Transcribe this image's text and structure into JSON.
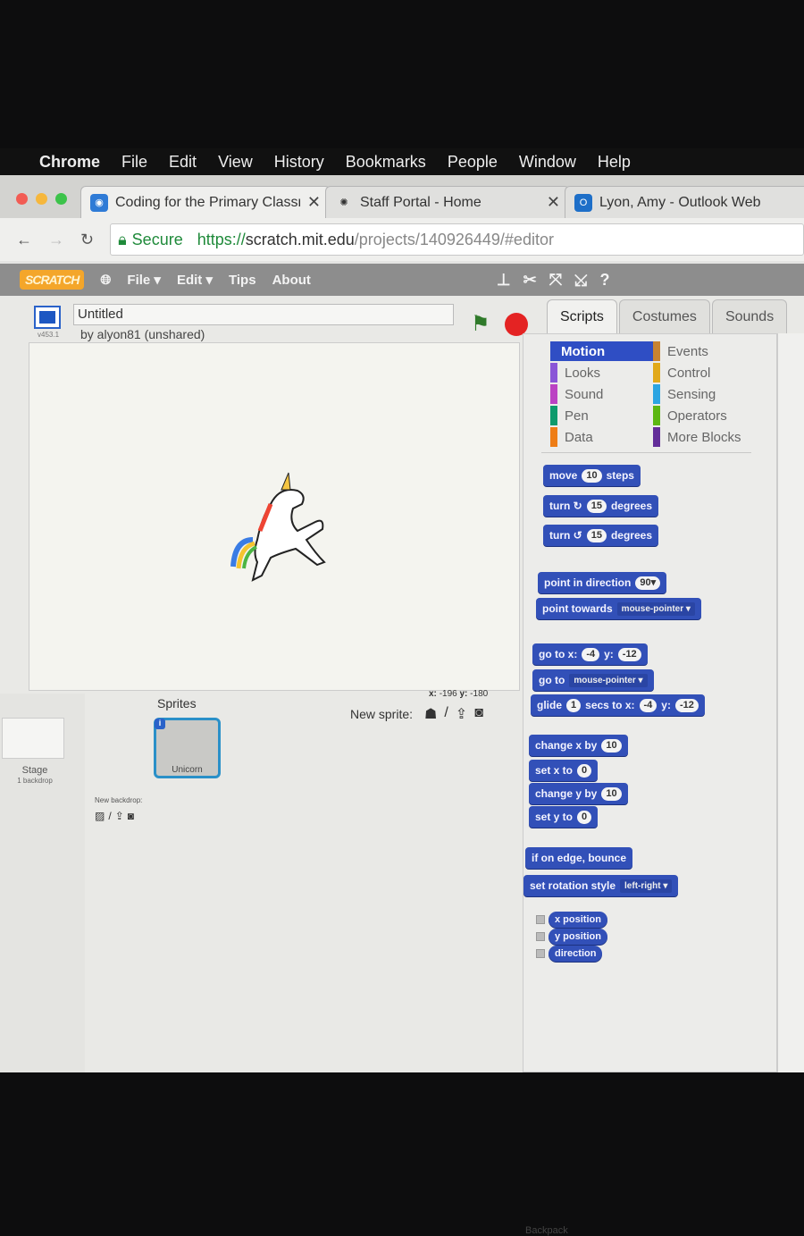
{
  "os_menu": {
    "app": "Chrome",
    "items": [
      "File",
      "Edit",
      "View",
      "History",
      "Bookmarks",
      "People",
      "Window",
      "Help"
    ]
  },
  "browser": {
    "tabs": [
      {
        "label": "Coding for the Primary Classroom",
        "icon": "scratch-favicon"
      },
      {
        "label": "Staff Portal - Home",
        "icon": "nsw-favicon"
      },
      {
        "label": "Lyon, Amy - Outlook Web",
        "icon": "outlook-favicon"
      }
    ],
    "secure_label": "Secure",
    "url_scheme": "https://",
    "url_host": "scratch.mit.edu",
    "url_path": "/projects/140926449/#editor"
  },
  "scratch": {
    "logo": "SCRATCH",
    "menu": [
      "File ▾",
      "Edit ▾",
      "Tips",
      "About"
    ],
    "project_title": "Untitled",
    "author": "by alyon81 (unshared)",
    "version": "v453.1",
    "tabs": [
      "Scripts",
      "Costumes",
      "Sounds"
    ],
    "categories": [
      {
        "label": "Motion",
        "color": "#4a6cd4"
      },
      {
        "label": "Looks",
        "color": "#8a55d7"
      },
      {
        "label": "Sound",
        "color": "#bb42c3"
      },
      {
        "label": "Pen",
        "color": "#0e9a6c"
      },
      {
        "label": "Data",
        "color": "#ee7d16"
      },
      {
        "label": "Events",
        "color": "#c88330"
      },
      {
        "label": "Control",
        "color": "#e1a91a"
      },
      {
        "label": "Sensing",
        "color": "#2ca5e2"
      },
      {
        "label": "Operators",
        "color": "#5cb712"
      },
      {
        "label": "More Blocks",
        "color": "#632d99"
      }
    ],
    "coords": {
      "x_label": "x:",
      "x": "-196",
      "y_label": "y:",
      "y": "-180"
    },
    "sprites_label": "Sprites",
    "new_sprite_label": "New sprite:",
    "stage_label": "Stage",
    "stage_sub": "1 backdrop",
    "new_backdrop_label": "New backdrop:",
    "sprite": {
      "name": "Unicorn"
    },
    "backpack": "Backpack",
    "blocks": [
      [
        {
          "t": "move"
        },
        {
          "n": "10"
        },
        {
          "t": "steps"
        }
      ],
      [
        {
          "t": "turn ↻"
        },
        {
          "n": "15"
        },
        {
          "t": "degrees"
        }
      ],
      [
        {
          "t": "turn ↺"
        },
        {
          "n": "15"
        },
        {
          "t": "degrees"
        }
      ],
      [
        {
          "t": "point in direction"
        },
        {
          "n": "90▾"
        }
      ],
      [
        {
          "t": "point towards"
        },
        {
          "d": "mouse-pointer ▾"
        }
      ],
      [
        {
          "t": "go to x:"
        },
        {
          "n": "-4"
        },
        {
          "t": "y:"
        },
        {
          "n": "-12"
        }
      ],
      [
        {
          "t": "go to"
        },
        {
          "d": "mouse-pointer ▾"
        }
      ],
      [
        {
          "t": "glide"
        },
        {
          "n": "1"
        },
        {
          "t": "secs to x:"
        },
        {
          "n": "-4"
        },
        {
          "t": "y:"
        },
        {
          "n": "-12"
        }
      ],
      [
        {
          "t": "change x by"
        },
        {
          "n": "10"
        }
      ],
      [
        {
          "t": "set x to"
        },
        {
          "n": "0"
        }
      ],
      [
        {
          "t": "change y by"
        },
        {
          "n": "10"
        }
      ],
      [
        {
          "t": "set y to"
        },
        {
          "n": "0"
        }
      ],
      [
        {
          "t": "if on edge, bounce"
        }
      ],
      [
        {
          "t": "set rotation style"
        },
        {
          "d": "left-right ▾"
        }
      ],
      [
        {
          "t": "x position"
        }
      ],
      [
        {
          "t": "y position"
        }
      ],
      [
        {
          "t": "direction"
        }
      ]
    ]
  }
}
